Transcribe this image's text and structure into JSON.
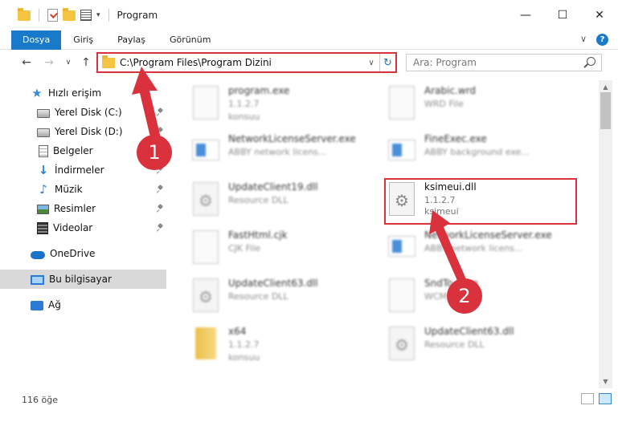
{
  "window": {
    "title": "Program",
    "minimize": "—",
    "maximize": "☐",
    "close": "✕"
  },
  "ribbon": {
    "tabs": [
      "Dosya",
      "Giriş",
      "Paylaş",
      "Görünüm"
    ],
    "expand": "∨",
    "help": "?"
  },
  "nav": {
    "back": "←",
    "forward": "→",
    "recent": "∨",
    "up": "↑",
    "address": "C:\\Program Files\\Program Dizini",
    "dropdown": "∨",
    "refresh": "↻",
    "search_placeholder": "Ara: Program"
  },
  "sidebar": {
    "items": [
      {
        "label": "Hızlı erişim",
        "icon": "star-icon"
      },
      {
        "label": "Yerel Disk (C:)",
        "icon": "disk-icon"
      },
      {
        "label": "Yerel Disk (D:)",
        "icon": "disk-icon"
      },
      {
        "label": "Belgeler",
        "icon": "documents-icon"
      },
      {
        "label": "İndirmeler",
        "icon": "downloads-icon"
      },
      {
        "label": "Müzik",
        "icon": "music-icon"
      },
      {
        "label": "Resimler",
        "icon": "pictures-icon"
      },
      {
        "label": "Videolar",
        "icon": "videos-icon"
      },
      {
        "label": "OneDrive",
        "icon": "onedrive-icon"
      },
      {
        "label": "Bu bilgisayar",
        "icon": "this-pc-icon"
      },
      {
        "label": "Ağ",
        "icon": "network-icon"
      }
    ]
  },
  "files": [
    {
      "name": "program.exe",
      "line2": "1.1.2.7",
      "line3": "konsuu",
      "icon": "exe"
    },
    {
      "name": "Arabic.wrd",
      "line2": "WRD File",
      "line3": "",
      "icon": "doc"
    },
    {
      "name": "NetworkLicenseServer.exe",
      "line2": "ABBY network licens...",
      "line3": "",
      "icon": "exe"
    },
    {
      "name": "FineExec.exe",
      "line2": "ABBY background exe...",
      "line3": "",
      "icon": "exe"
    },
    {
      "name": "UpdateClient19.dll",
      "line2": "Resource DLL",
      "line3": "",
      "icon": "dll"
    },
    {
      "name": "ksimeui.dll",
      "line2": "1.1.2.7",
      "line3": "ksimeui",
      "icon": "dll"
    },
    {
      "name": "FastHtml.cjk",
      "line2": "CJK File",
      "line3": "",
      "icon": "doc"
    },
    {
      "name": "NetworkLicenseServer.exe",
      "line2": "ABBY network licens...",
      "line3": "",
      "icon": "exe"
    },
    {
      "name": "UpdateClient63.dll",
      "line2": "Resource DLL",
      "line3": "",
      "icon": "dll"
    },
    {
      "name": "SndTo.wcm",
      "line2": "WCM File",
      "line3": "",
      "icon": "doc"
    },
    {
      "name": "x64",
      "line2": "1.1.2.7",
      "line3": "konsuu",
      "icon": "folder"
    },
    {
      "name": "UpdateClient63.dll",
      "line2": "Resource DLL",
      "line3": "",
      "icon": "dll"
    }
  ],
  "status": {
    "count": "116 öğe"
  },
  "annotations": {
    "step1": "1",
    "step2": "2",
    "color": "#d9323c"
  }
}
